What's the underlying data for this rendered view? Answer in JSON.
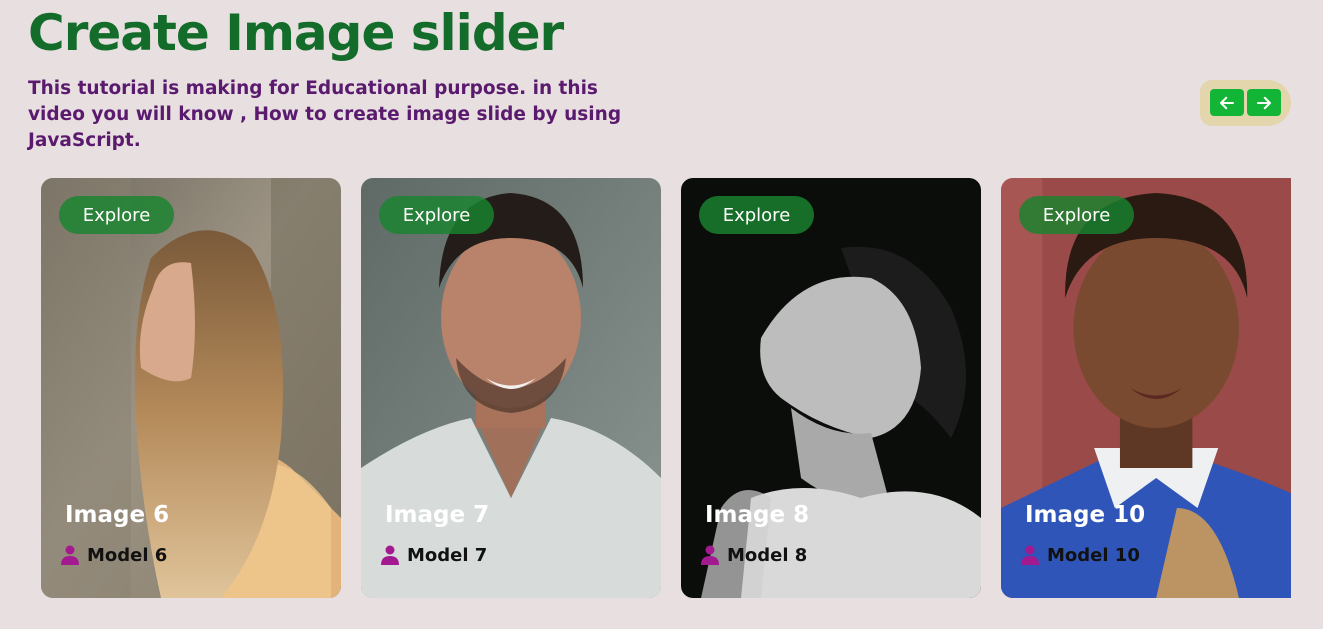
{
  "header": {
    "title": "Create Image slider",
    "subtitle": "This tutorial is making for Educational purpose. in this video you will know , How to create image slide by using JavaScript."
  },
  "nav": {
    "prev_icon": "arrow-left-icon",
    "next_icon": "arrow-right-icon",
    "accent_color": "#13b536",
    "panel_color": "#e3d6ad"
  },
  "cards": [
    {
      "explore_label": "Explore",
      "title": "Image 6",
      "model": "Model 6"
    },
    {
      "explore_label": "Explore",
      "title": "Image 7",
      "model": "Model 7"
    },
    {
      "explore_label": "Explore",
      "title": "Image 8",
      "model": "Model 8"
    },
    {
      "explore_label": "Explore",
      "title": "Image 10",
      "model": "Model 10"
    }
  ],
  "colors": {
    "background": "#e8dfe0",
    "title": "#146c2a",
    "subtitle": "#5a1a6e",
    "user_icon": "#a3198f"
  }
}
